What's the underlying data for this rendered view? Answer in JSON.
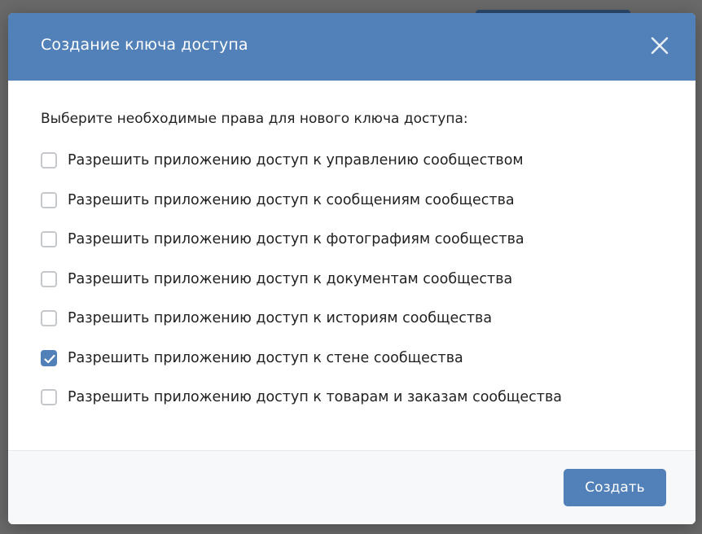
{
  "modal": {
    "title": "Создание ключа доступа",
    "intro": "Выберите необходимые права для нового ключа доступа:",
    "options": [
      {
        "label": "Разрешить приложению доступ к управлению сообществом",
        "checked": false
      },
      {
        "label": "Разрешить приложению доступ к сообщениям сообщества",
        "checked": false
      },
      {
        "label": "Разрешить приложению доступ к фотографиям сообщества",
        "checked": false
      },
      {
        "label": "Разрешить приложению доступ к документам сообщества",
        "checked": false
      },
      {
        "label": "Разрешить приложению доступ к историям сообщества",
        "checked": false
      },
      {
        "label": "Разрешить приложению доступ к стене сообщества",
        "checked": true
      },
      {
        "label": "Разрешить приложению доступ к товарам и заказам сообщества",
        "checked": false
      }
    ],
    "create_label": "Создать"
  },
  "colors": {
    "header": "#5181b8",
    "accent": "#5181b8",
    "footer": "#f7f8fa"
  },
  "icons": {
    "close": "close-icon",
    "check": "checkmark-icon"
  }
}
